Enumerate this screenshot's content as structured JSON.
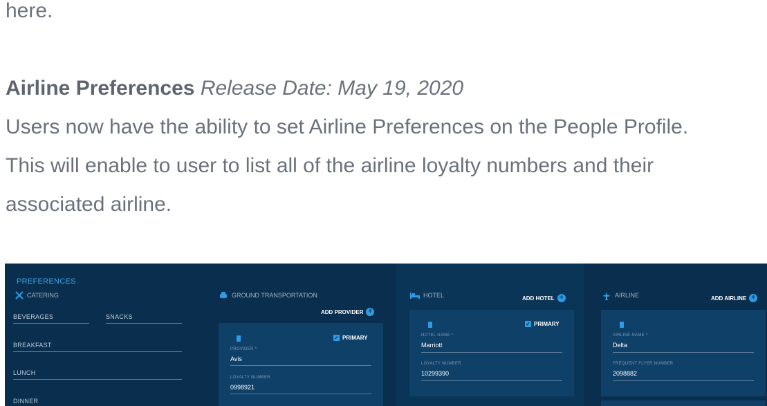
{
  "article": {
    "line_here": "here.",
    "heading_bold": "Airline Preferences",
    "heading_italic": "Release Date: May 19, 2020",
    "para_1": "Users now have the ability to set Airline Preferences on the People Profile.",
    "para_2": "This will enable to user to list all of the airline loyalty numbers and their",
    "para_3": "associated airline."
  },
  "app": {
    "title": "PREFERENCES",
    "catering": {
      "title": "CATERING",
      "beverages": "BEVERAGES",
      "snacks": "SNACKS",
      "breakfast": "BREAKFAST",
      "lunch": "LUNCH",
      "dinner": "DINNER"
    },
    "ground": {
      "title": "GROUND TRANSPORTATION",
      "add_label": "ADD PROVIDER",
      "primary_label": "PRIMARY",
      "provider_label": "PROVIDER *",
      "provider_value": "Avis",
      "loyalty_label": "LOYALTY NUMBER",
      "loyalty_value": "0998921"
    },
    "hotel": {
      "title": "HOTEL",
      "add_label": "ADD HOTEL",
      "primary_label": "PRIMARY",
      "name_label": "HOTEL NAME *",
      "name_value": "Marriott",
      "loyalty_label": "LOYALTY NUMBER",
      "loyalty_value": "10299390"
    },
    "airline": {
      "title": "AIRLINE",
      "add_label": "ADD AIRLINE",
      "name_label": "AIRLINE NAME *",
      "name_value": "Delta",
      "ff_label": "FREQUENT FLYER NUMBER",
      "ff_value": "2098882"
    },
    "colors": {
      "background": "#0a2f4e",
      "card": "#0f4068",
      "accent": "#2e9be6"
    }
  }
}
